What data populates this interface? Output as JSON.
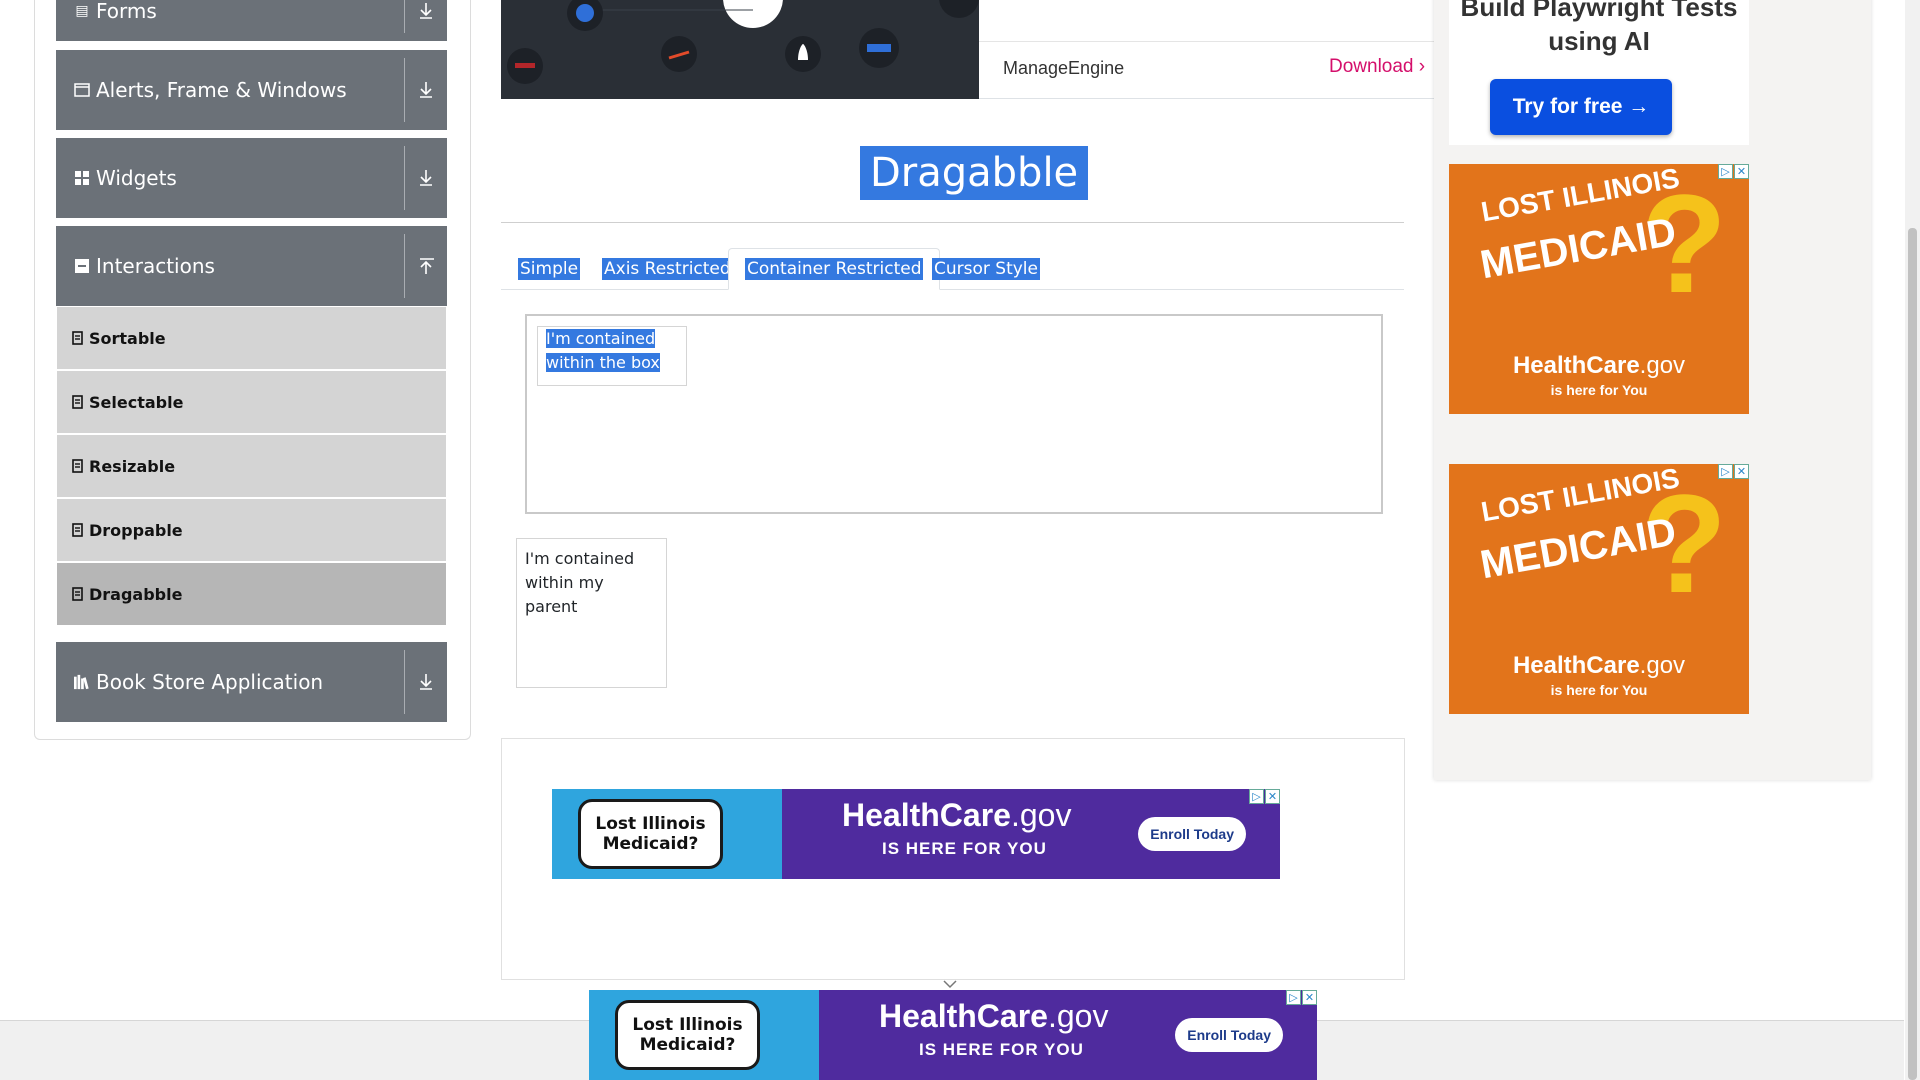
{
  "sidebar": {
    "groups": [
      {
        "label": "Forms",
        "icon": "form-icon",
        "arrow": "download-arrow-icon"
      },
      {
        "label": "Alerts, Frame & Windows",
        "icon": "window-icon",
        "arrow": "download-arrow-icon"
      },
      {
        "label": "Widgets",
        "icon": "widgets-icon",
        "arrow": "download-arrow-icon"
      },
      {
        "label": "Interactions",
        "icon": "interactions-icon",
        "arrow": "upload-arrow-icon"
      },
      {
        "label": "Book Store Application",
        "icon": "books-icon",
        "arrow": "download-arrow-icon"
      }
    ],
    "items": [
      {
        "label": "Sortable"
      },
      {
        "label": "Selectable"
      },
      {
        "label": "Resizable"
      },
      {
        "label": "Droppable"
      },
      {
        "label": "Dragabble",
        "active": true
      }
    ]
  },
  "top_ad": {
    "vendor": "ManageEngine",
    "download_label": "Download",
    "chevron": "›"
  },
  "main": {
    "title": "Dragabble",
    "tabs": [
      {
        "label": "Simple"
      },
      {
        "label": "Axis Restricted"
      },
      {
        "label": "Container Restricted",
        "active": true
      },
      {
        "label": "Cursor Style"
      }
    ],
    "box_text": "I'm contained within the box",
    "parent_text": "I'm contained within my parent"
  },
  "right_ads": {
    "playwright_title": "Build Playwright Tests using AI",
    "try_button": "Try for free →",
    "medicaid_line1": "LOST ILLINOIS",
    "medicaid_line2": "MEDICAID",
    "healthcare_brand": "HealthCare",
    "healthcare_tld": ".gov",
    "here_for_you": "is here for You"
  },
  "banner_ad": {
    "badge_line1": "Lost Illinois",
    "badge_line2": "Medicaid?",
    "brand": "HealthCare",
    "tld": ".gov",
    "tagline": "IS HERE FOR YOU",
    "cta": "Enroll Today"
  },
  "colors": {
    "accent": "#3479e0",
    "sidebar_header": "#6b7178",
    "sidebar_item": "#d4d4d4",
    "download_link": "#d40f6b",
    "ad_purple": "#4f2b9e",
    "ad_orange": "#e2741b"
  }
}
